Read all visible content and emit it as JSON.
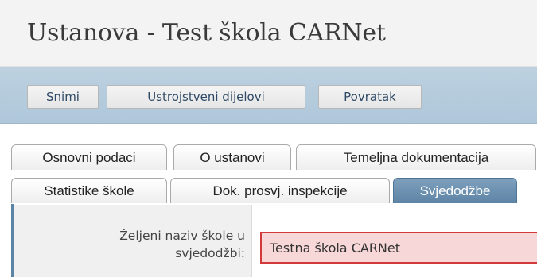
{
  "header": {
    "title": "Ustanova - Test škola CARNet"
  },
  "toolbar": {
    "buttons": [
      "Snimi",
      "Ustrojstveni dijelovi",
      "Povratak"
    ]
  },
  "tabs": {
    "row1": [
      "Osnovni podaci",
      "O ustanovi",
      "Temeljna dokumentacija"
    ],
    "row2": [
      "Statistike škole",
      "Dok. prosvj. inspekcije",
      "Svjedodžbe"
    ],
    "active": "Svjedodžbe"
  },
  "form": {
    "school_name_label": "Željeni naziv škole u svjedodžbi:",
    "school_name_value": "Testna škola CARNet"
  },
  "colors": {
    "toolbar_bg": "#aec7da",
    "active_tab": "#5d83a5",
    "input_error_border": "#d23a3a",
    "input_error_bg": "#f7d7d7"
  }
}
